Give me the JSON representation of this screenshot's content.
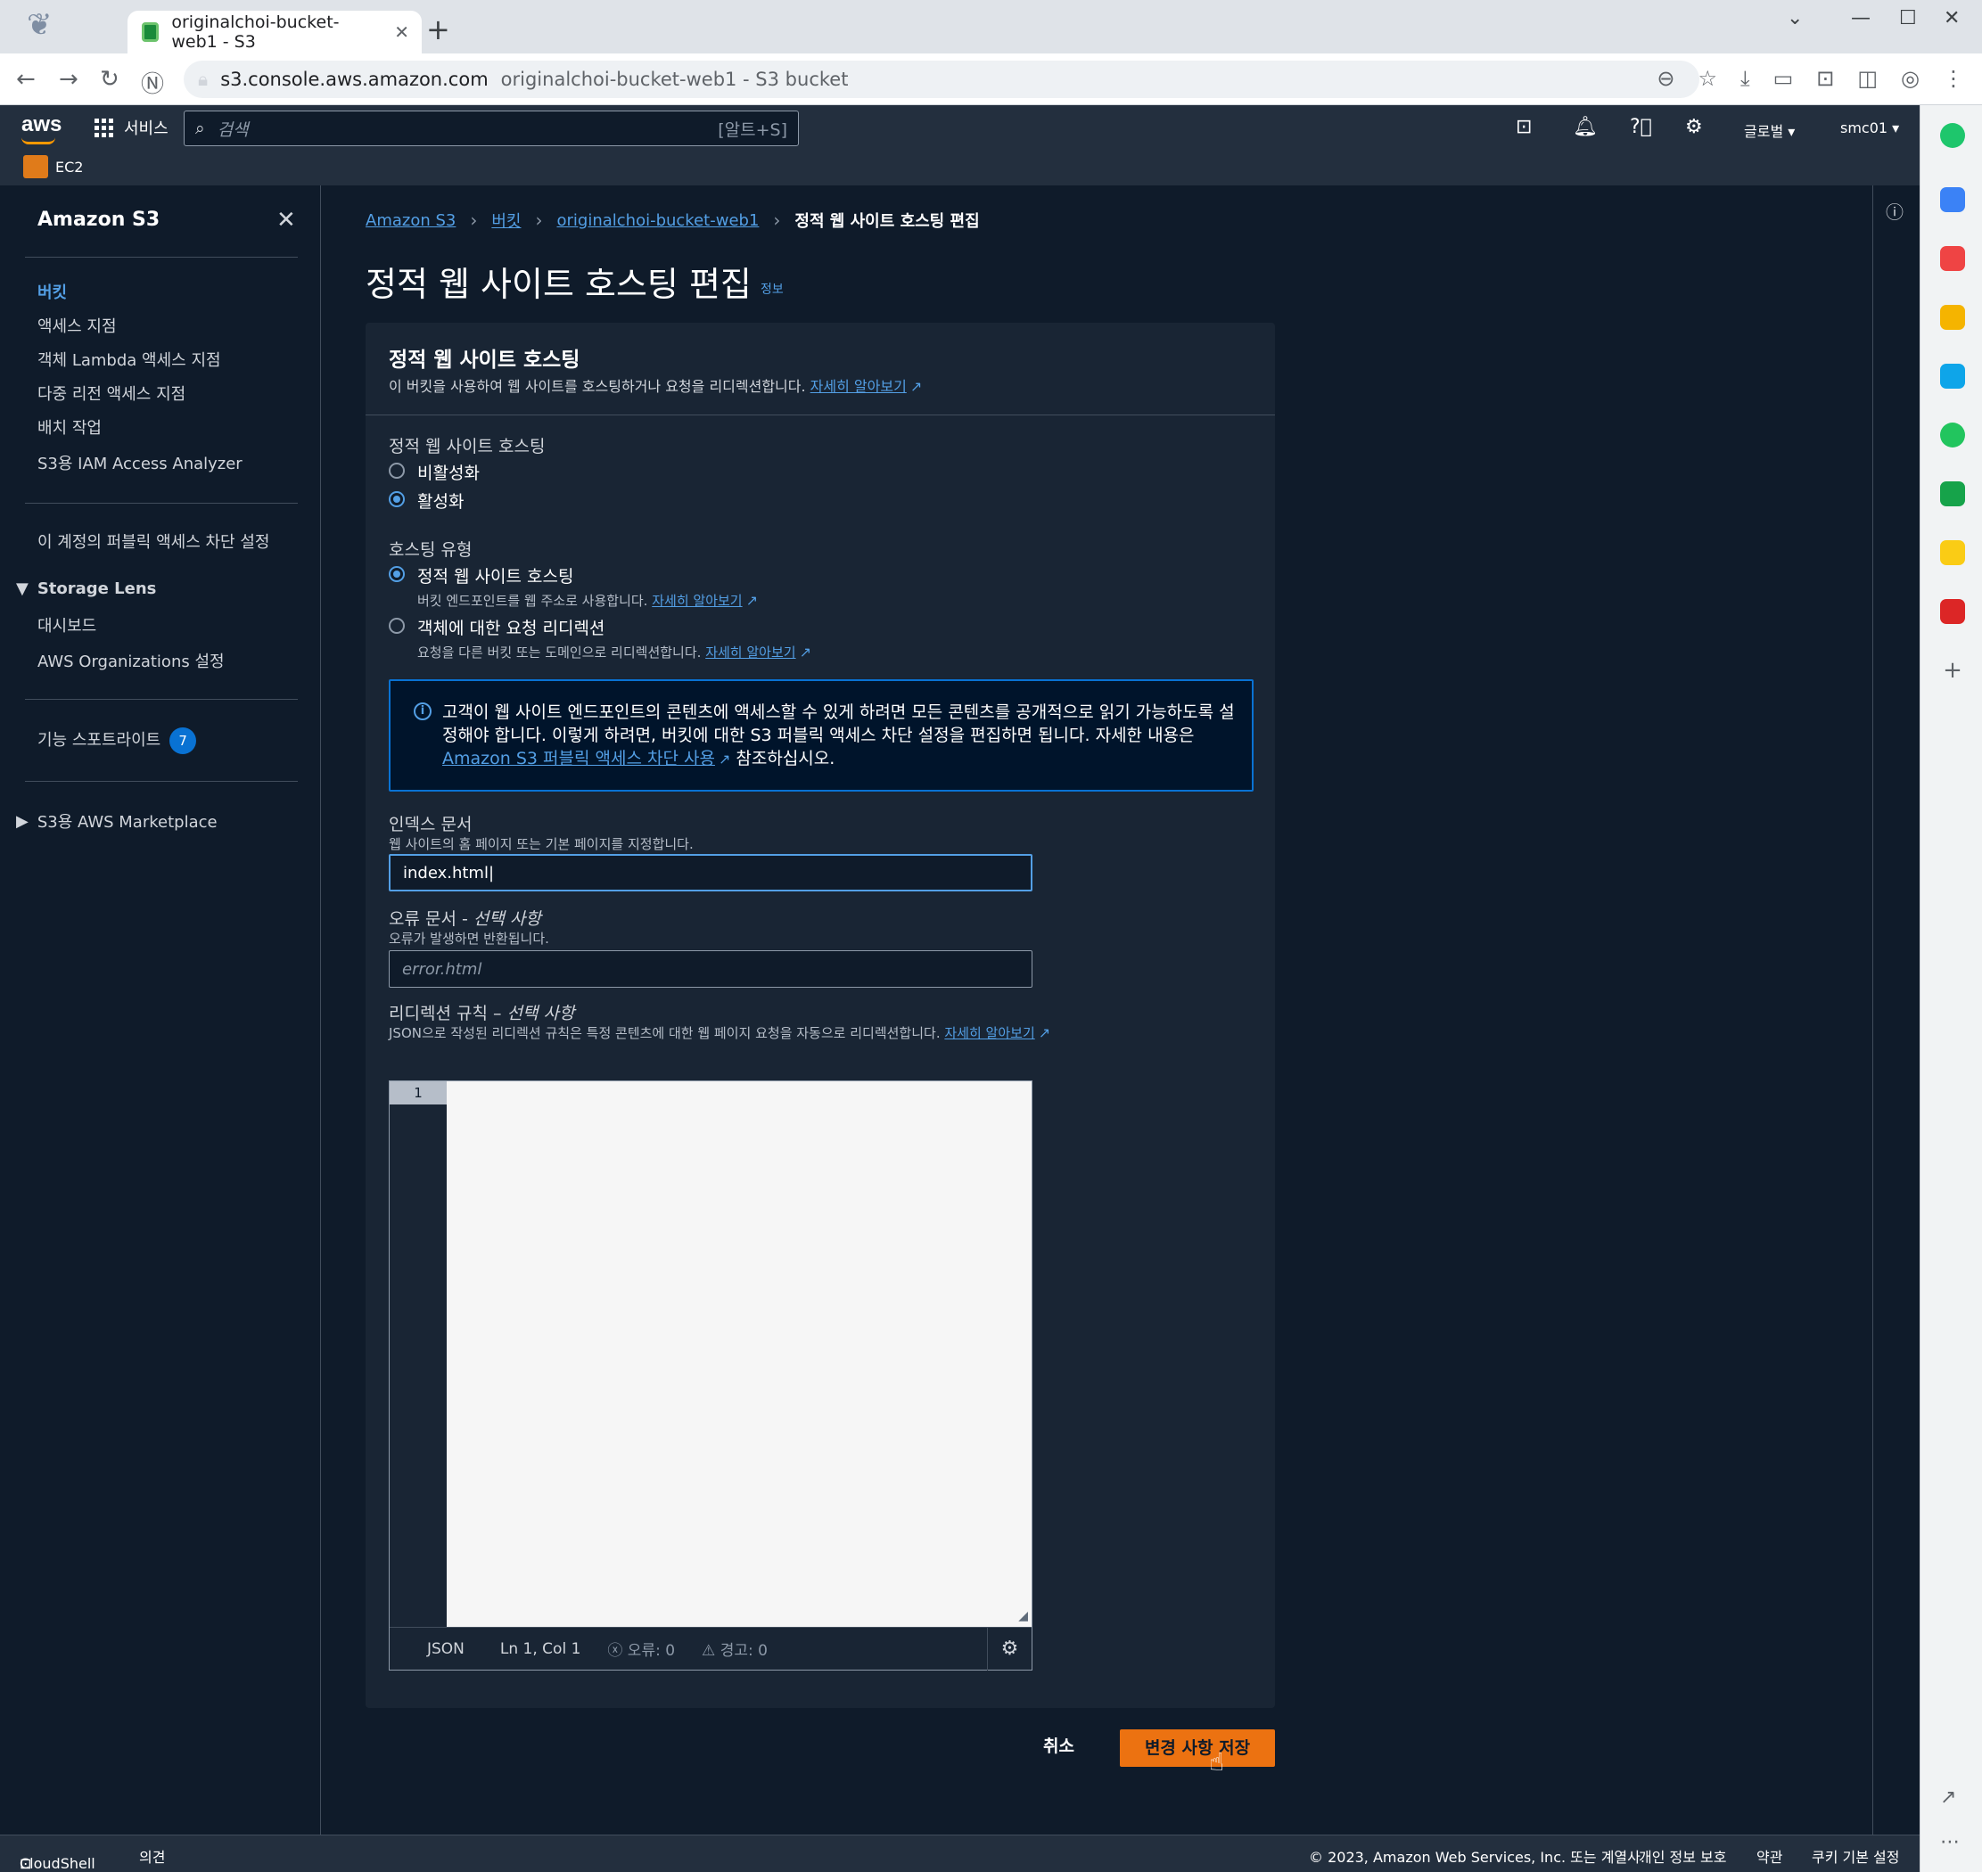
{
  "browser": {
    "tab_title": "originalchoi-bucket-web1 - S3 ",
    "url_host": "s3.console.aws.amazon.com",
    "url_title": "originalchoi-bucket-web1 - S3 bucket"
  },
  "header": {
    "logo": "aws",
    "services_label": "서비스",
    "search_placeholder": "검색",
    "search_shortcut": "[알트+S]",
    "region_label": "글로벌 ▾",
    "account_label": "smc01 ▾",
    "favorite_label": "EC2"
  },
  "nav": {
    "title": "Amazon S3",
    "items": [
      {
        "label": "버킷"
      },
      {
        "label": "액세스 지점"
      },
      {
        "label": "객체 Lambda 액세스 지점"
      },
      {
        "label": "다중 리전 액세스 지점"
      },
      {
        "label": "배치 작업"
      },
      {
        "label": "S3용 IAM Access Analyzer"
      }
    ],
    "block_public": "이 계정의 퍼블릭 액세스 차단 설정",
    "storage_lens": {
      "title": "Storage Lens",
      "items": [
        {
          "label": "대시보드"
        },
        {
          "label": "AWS Organizations 설정"
        }
      ]
    },
    "spotlight": {
      "label": "기능 스포트라이트",
      "count": "7"
    },
    "marketplace": "S3용 AWS Marketplace"
  },
  "breadcrumb": [
    {
      "label": "Amazon S3"
    },
    {
      "label": "버킷"
    },
    {
      "label": "originalchoi-bucket-web1"
    },
    {
      "label": "정적 웹 사이트 호스팅 편집"
    }
  ],
  "page": {
    "title": "정적 웹 사이트 호스팅 편집",
    "info_link": "정보"
  },
  "panel": {
    "title": "정적 웹 사이트 호스팅",
    "desc": "이 버킷을 사용하여 웹 사이트를 호스팅하거나 요청을 리디렉션합니다.",
    "learn_more": "자세히 알아보기",
    "hosting_label": "정적 웹 사이트 호스팅",
    "hosting_options": [
      {
        "label": "비활성화",
        "selected": false
      },
      {
        "label": "활성화",
        "selected": true
      }
    ],
    "type_label": "호스팅 유형",
    "type_options": [
      {
        "label": "정적 웹 사이트 호스팅",
        "desc": "버킷 엔드포인트를 웹 주소로 사용합니다.",
        "selected": true
      },
      {
        "label": "객체에 대한 요청 리디렉션",
        "desc": "요청을 다른 버킷 또는 도메인으로 리디렉션합니다.",
        "selected": false
      }
    ],
    "alert": {
      "text": "고객이 웹 사이트 엔드포인트의 콘텐츠에 액세스할 수 있게 하려면 모든 콘텐츠를 공개적으로 읽기 가능하도록 설정해야 합니다. 이렇게 하려면, 버킷에 대한 S3 퍼블릭 액세스 차단 설정을 편집하면 됩니다. 자세한 내용은 ",
      "link": "Amazon S3 퍼블릭 액세스 차단 사용",
      "suffix": " 참조하십시오."
    },
    "index": {
      "label": "인덱스 문서",
      "hint": "웹 사이트의 홈 페이지 또는 기본 페이지를 지정합니다.",
      "value": "index.html"
    },
    "error_doc": {
      "label": "오류 문서 - ",
      "optional": "선택 사항",
      "hint": "오류가 발생하면 반환됩니다.",
      "placeholder": "error.html"
    },
    "redirect": {
      "label": "리디렉션 규칙 – ",
      "optional": "선택 사항",
      "hint": "JSON으로 작성된 리디렉션 규칙은 특정 콘텐츠에 대한 웹 페이지 요청을 자동으로 리디렉션합니다."
    },
    "editor": {
      "line_number": "1",
      "language": "JSON",
      "position": "Ln 1, Col 1",
      "errors": "ⓧ 오류: 0",
      "warnings": "⚠ 경고: 0"
    }
  },
  "actions": {
    "cancel": "취소",
    "save": "변경 사항 저장"
  },
  "footer": {
    "cloudshell": "CloudShell",
    "feedback": "의견",
    "copyright": "© 2023, Amazon Web Services, Inc. 또는 계열사.",
    "privacy": "개인 정보 보호",
    "terms": "약관",
    "cookies": "쿠키 기본 설정"
  },
  "colors": {
    "accent": "#539fe5",
    "primary_button": "#ec7211",
    "background": "#0f1b2a",
    "header": "#232f3e"
  }
}
